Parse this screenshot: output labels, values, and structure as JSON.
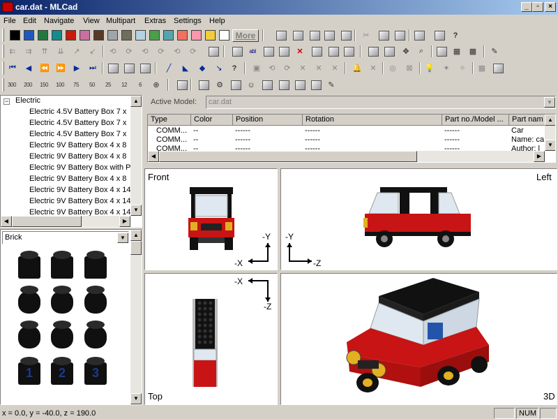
{
  "window": {
    "title": "car.dat - MLCad"
  },
  "menu": [
    "File",
    "Edit",
    "Navigate",
    "View",
    "Multipart",
    "Extras",
    "Settings",
    "Help"
  ],
  "colors": {
    "swatches": [
      "#000000",
      "#1f57c0",
      "#237841",
      "#158b8d",
      "#c91a09",
      "#c870a0",
      "#583927",
      "#a0a5a9",
      "#6d6e5c",
      "#b4d2e3",
      "#4b9f4a",
      "#55a5af",
      "#f2705e",
      "#fc97ac",
      "#f2cd37",
      "#ffffff"
    ],
    "more_label": "More"
  },
  "zoom_labels": [
    "300",
    "200",
    "150",
    "100",
    "75",
    "50",
    "25",
    "12",
    "6"
  ],
  "tree": {
    "root": "Electric",
    "items": [
      "Electric  4.5V Battery Box  7 x",
      "Electric  4.5V Battery Box  7 x",
      "Electric  4.5V Battery Box  7 x",
      "Electric  9V Battery Box  4 x  8",
      "Electric  9V Battery Box  4 x  8",
      "Electric  9V Battery Box with P",
      "Electric 9V Battery Box  4 x  8",
      "Electric 9V Battery Box  4 x 14",
      "Electric 9V Battery Box  4 x 14",
      "Electric 9V Battery Box  4 x 14"
    ]
  },
  "parts": {
    "category": "Brick",
    "numbers": [
      "1",
      "2",
      "3"
    ]
  },
  "model": {
    "label": "Active Model:",
    "value": "car.dat"
  },
  "table": {
    "headers": [
      "Type",
      "Color",
      "Position",
      "Rotation",
      "Part no./Model ...",
      "Part nam"
    ],
    "rows": [
      [
        "COMM...",
        "--",
        "------",
        "------",
        "------",
        "Car"
      ],
      [
        "COMM...",
        "--",
        "------",
        "------",
        "------",
        "Name: ca"
      ],
      [
        "COMM...",
        "--",
        "------",
        "------",
        "------",
        "Author: l"
      ]
    ]
  },
  "views": {
    "front": "Front",
    "left": "Left",
    "top": "Top",
    "d3": "3D"
  },
  "axes": {
    "front_y": "-Y",
    "front_x": "-X",
    "left_y": "-Y",
    "left_z": "-Z",
    "top_x": "-X",
    "top_z": "-Z"
  },
  "status": {
    "coords": "x = 0.0, y = -40.0, z = 190.0",
    "num": "NUM"
  }
}
